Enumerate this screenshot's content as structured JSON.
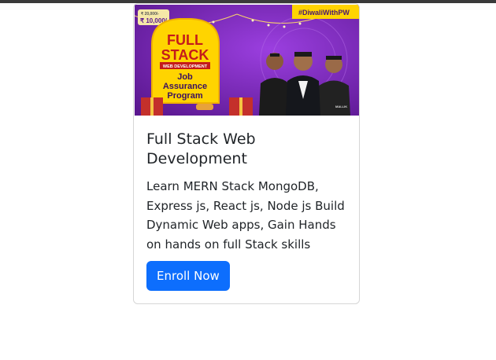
{
  "card": {
    "banner": {
      "price_strike": "₹ 20,000/-",
      "price": "₹ 10,000/-",
      "hashtag": "#DiwaliWithPW",
      "title_line1": "FULL",
      "title_line2": "STACK",
      "ribbon": "WEB DEVELOPMENT",
      "sub_line1": "Job",
      "sub_line2": "Assurance",
      "sub_line3": "Program",
      "shirt_text": "MALLIK"
    },
    "title": "Full Stack Web Development",
    "description": "Learn MERN Stack MongoDB, Express js, React js, Node js Build Dynamic Web apps, Gain Hands on hands on full Stack skills",
    "button_label": "Enroll Now",
    "colors": {
      "button": "#0d6efd",
      "banner_purple": "#6a1fb0",
      "banner_yellow": "#ffd400"
    }
  }
}
